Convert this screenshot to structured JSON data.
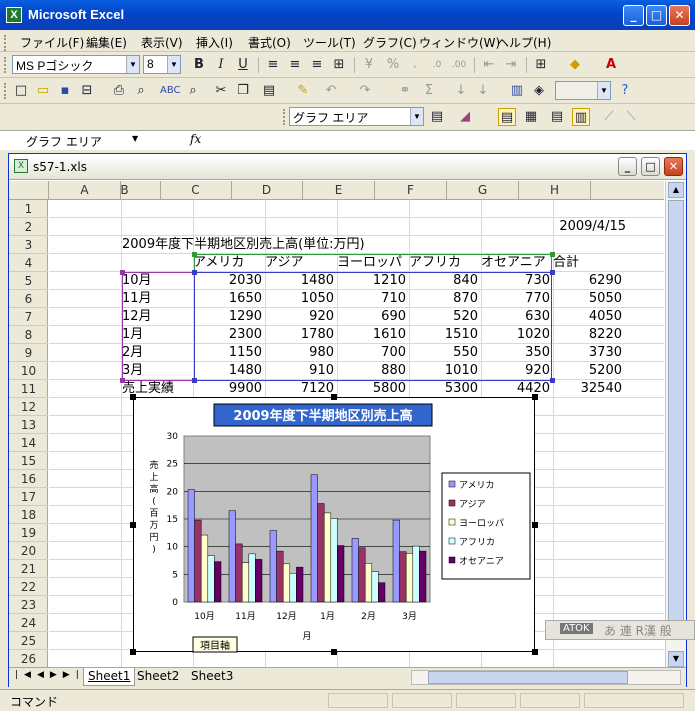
{
  "app": {
    "title": "Microsoft Excel"
  },
  "menu": [
    "ファイル(F)",
    "編集(E)",
    "表示(V)",
    "挿入(I)",
    "書式(O)",
    "ツール(T)",
    "グラフ(C)",
    "ウィンドウ(W)",
    "ヘルプ(H)"
  ],
  "format_toolbar": {
    "font": "MS Pゴシック",
    "size": "8"
  },
  "chart_toolbar": {
    "object": "グラフ エリア"
  },
  "formula_bar": {
    "name_box": "グラフ エリア",
    "fx": "fx"
  },
  "workbook": {
    "title": "s57-1.xls"
  },
  "columns": [
    "A",
    "B",
    "C",
    "D",
    "E",
    "F",
    "G",
    "H"
  ],
  "rows": [
    "1",
    "2",
    "3",
    "4",
    "5",
    "6",
    "7",
    "8",
    "9",
    "10",
    "11",
    "12",
    "13",
    "14",
    "15",
    "16",
    "17",
    "18",
    "19",
    "20",
    "21",
    "22",
    "23",
    "24",
    "25",
    "26"
  ],
  "sheet": {
    "date": "2009/4/15",
    "heading": "2009年度下半期地区別売上高(単位:万円)",
    "col_headers": [
      "アメリカ",
      "アジア",
      "ヨーロッパ",
      "アフリカ",
      "オセアニア",
      "合計"
    ],
    "data_rows": [
      {
        "label": "10月",
        "values": [
          "2030",
          "1480",
          "1210",
          "840",
          "730",
          "6290"
        ]
      },
      {
        "label": "11月",
        "values": [
          "1650",
          "1050",
          "710",
          "870",
          "770",
          "5050"
        ]
      },
      {
        "label": "12月",
        "values": [
          "1290",
          "920",
          "690",
          "520",
          "630",
          "4050"
        ]
      },
      {
        "label": "1月",
        "values": [
          "2300",
          "1780",
          "1610",
          "1510",
          "1020",
          "8220"
        ]
      },
      {
        "label": "2月",
        "values": [
          "1150",
          "980",
          "700",
          "550",
          "350",
          "3730"
        ]
      },
      {
        "label": "3月",
        "values": [
          "1480",
          "910",
          "880",
          "1010",
          "920",
          "5200"
        ]
      }
    ],
    "total_row": {
      "label": "売上実績",
      "values": [
        "9900",
        "7120",
        "5800",
        "5300",
        "4420",
        "32540"
      ]
    }
  },
  "chart_data": {
    "type": "bar",
    "title": "2009年度下半期地区別売上高",
    "categories": [
      "10月",
      "11月",
      "12月",
      "1月",
      "2月",
      "3月"
    ],
    "series": [
      {
        "name": "アメリカ",
        "color": "#9999ff",
        "values": [
          20.3,
          16.5,
          12.9,
          23.0,
          11.5,
          14.8
        ]
      },
      {
        "name": "アジア",
        "color": "#993366",
        "values": [
          14.8,
          10.5,
          9.2,
          17.8,
          9.8,
          9.1
        ]
      },
      {
        "name": "ヨーロッパ",
        "color": "#ffffcc",
        "values": [
          12.1,
          7.1,
          6.9,
          16.1,
          7.0,
          8.8
        ]
      },
      {
        "name": "アフリカ",
        "color": "#ccffff",
        "values": [
          8.4,
          8.7,
          5.2,
          15.1,
          5.5,
          10.1
        ]
      },
      {
        "name": "オセアニア",
        "color": "#660066",
        "values": [
          7.3,
          7.7,
          6.3,
          10.2,
          3.5,
          9.2
        ]
      }
    ],
    "xlabel": "月",
    "ylabel": "売上高(百万円)",
    "ylim": [
      0,
      30
    ],
    "yticks": [
      "0",
      "5",
      "10",
      "15",
      "20",
      "25",
      "30"
    ],
    "plot_bg": "#c0c0c0",
    "grid": true,
    "legend": "right",
    "tooltip": "項目軸"
  },
  "tabs": [
    "Sheet1",
    "Sheet2",
    "Sheet3"
  ],
  "status": {
    "mode": "コマンド"
  },
  "ime": {
    "label": "ATOK",
    "modes": "あ 連 R漢 般"
  }
}
